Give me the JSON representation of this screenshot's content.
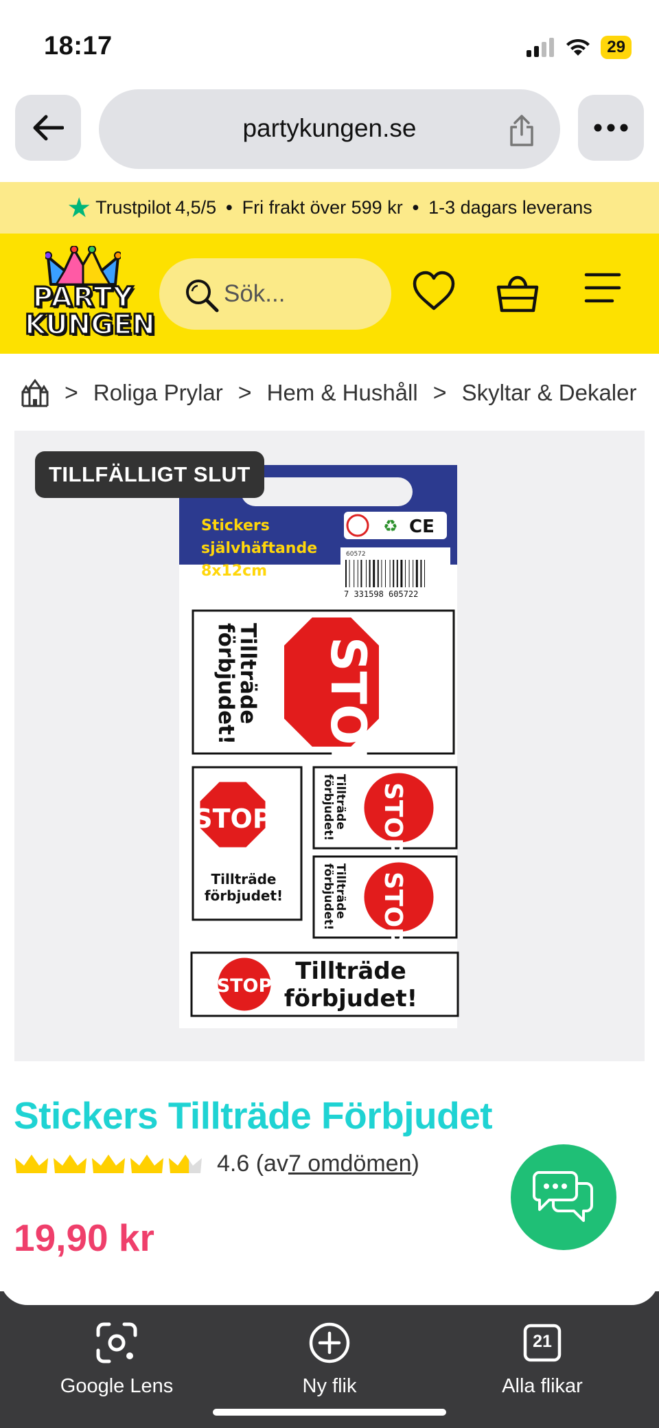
{
  "status": {
    "time": "18:17",
    "battery": "29"
  },
  "browser": {
    "url": "partykungen.se"
  },
  "promo": {
    "trustpilot": "Trustpilot",
    "rating": "4,5/5",
    "shipping": "Fri frakt över 599 kr",
    "delivery": "1-3 dagars leverans"
  },
  "header": {
    "logo_line1": "PARTY",
    "logo_line2": "KUNGEN",
    "search_placeholder": "Sök..."
  },
  "breadcrumb": {
    "items": [
      "Roliga Prylar",
      "Hem & Hushåll",
      "Skyltar & Dekaler"
    ]
  },
  "product": {
    "badge": "TILLFÄLLIGT SLUT",
    "package_label_line1": "Stickers",
    "package_label_line2": "självhäftande",
    "package_label_line3": "8x12cm",
    "barcode_number": "7 331598 605722",
    "barcode_code": "60572",
    "stop_text": "STOP",
    "sticker_text_line1": "Tillträde",
    "sticker_text_line2": "förbjudet!",
    "title": "Stickers Tillträde Förbjudet",
    "rating_value": "4.6",
    "rating_prefix": "(av ",
    "rating_link": "7 omdömen",
    "rating_suffix": ")",
    "rating_stars": 4.6,
    "price": "19,90 kr"
  },
  "toolbar": {
    "lens_label": "Google Lens",
    "newtab_label": "Ny flik",
    "tabs_label": "Alla flikar",
    "tabs_count": "21"
  },
  "colors": {
    "brand_yellow": "#fde100",
    "promo_yellow": "#fcea8a",
    "title_teal": "#1fd3d3",
    "price_pink": "#ef3f6b",
    "chat_green": "#1fbf76",
    "trustpilot_green": "#00b67a"
  }
}
